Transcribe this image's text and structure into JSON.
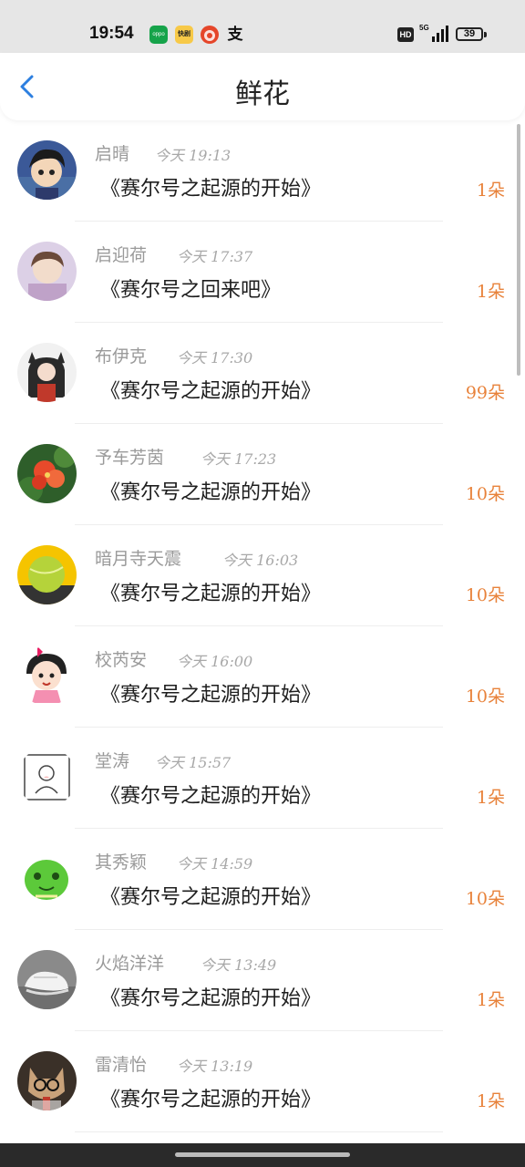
{
  "status_bar": {
    "time": "19:54",
    "apps": [
      "oppo",
      "快剧",
      "",
      "支"
    ],
    "network": "5G",
    "hd": "HD",
    "battery": "39"
  },
  "header": {
    "title": "鲜花"
  },
  "items": [
    {
      "name": "启晴",
      "time": "今天 19:13",
      "title": "《赛尔号之起源的开始》",
      "count": "1朵"
    },
    {
      "name": "启迎荷",
      "time": "今天 17:37",
      "title": "《赛尔号之回来吧》",
      "count": "1朵"
    },
    {
      "name": "布伊克",
      "time": "今天 17:30",
      "title": "《赛尔号之起源的开始》",
      "count": "99朵"
    },
    {
      "name": "予车芳茵",
      "time": "今天 17:23",
      "title": "《赛尔号之起源的开始》",
      "count": "10朵"
    },
    {
      "name": "暗月寺天震",
      "time": "今天 16:03",
      "title": "《赛尔号之起源的开始》",
      "count": "10朵"
    },
    {
      "name": "校芮安",
      "time": "今天 16:00",
      "title": "《赛尔号之起源的开始》",
      "count": "10朵"
    },
    {
      "name": "堂涛",
      "time": "今天 15:57",
      "title": "《赛尔号之起源的开始》",
      "count": "1朵"
    },
    {
      "name": "其秀颖",
      "time": "今天 14:59",
      "title": "《赛尔号之起源的开始》",
      "count": "10朵"
    },
    {
      "name": "火焰洋洋",
      "time": "今天 13:49",
      "title": "《赛尔号之起源的开始》",
      "count": "1朵"
    },
    {
      "name": "雷清怡",
      "time": "今天 13:19",
      "title": "《赛尔号之起源的开始》",
      "count": "1朵"
    }
  ],
  "colors": {
    "accent": "#2d7fe0",
    "count": "#e8823a",
    "name": "#9a9a9a"
  }
}
